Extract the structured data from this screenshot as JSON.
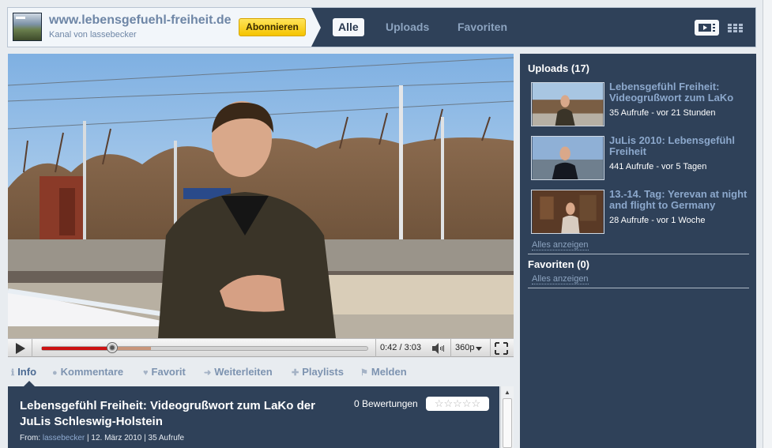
{
  "header": {
    "channel_title": "www.lebensgefuehl-freiheit.de",
    "channel_subtitle": "Kanal von lassebecker",
    "subscribe_label": "Abonnieren",
    "tabs": [
      {
        "label": "Alle",
        "active": true
      },
      {
        "label": "Uploads",
        "active": false
      },
      {
        "label": "Favoriten",
        "active": false
      }
    ],
    "view_icons": [
      "player-view-icon",
      "grid-view-icon"
    ]
  },
  "player": {
    "time": "0:42 / 3:03",
    "quality": "360p",
    "played_fraction": 0.215,
    "buffered_fraction": 0.335,
    "icons": [
      "play-icon",
      "volume-icon",
      "fullscreen-icon"
    ]
  },
  "actions": [
    {
      "label": "Info",
      "icon": "info-icon",
      "active": true
    },
    {
      "label": "Kommentare",
      "icon": "comment-icon",
      "active": false
    },
    {
      "label": "Favorit",
      "icon": "heart-icon",
      "active": false
    },
    {
      "label": "Weiterleiten",
      "icon": "forward-icon",
      "active": false
    },
    {
      "label": "Playlists",
      "icon": "plus-icon",
      "active": false
    },
    {
      "label": "Melden",
      "icon": "flag-icon",
      "active": false
    }
  ],
  "info": {
    "title": "Lebensgefühl Freiheit: Videogrußwort zum LaKo der JuLis Schleswig-Holstein",
    "ratings": "0 Bewertungen",
    "stars_filled": 0,
    "stars_total": 5,
    "from_label": "From:",
    "author": "lassebecker",
    "date": "12. März 2010",
    "views": "35 Aufrufe"
  },
  "sidebar": {
    "uploads_title": "Uploads (17)",
    "uploads": [
      {
        "title": "Lebensgefühl Freiheit: Videogrußwort zum LaKo",
        "meta": "35 Aufrufe - vor 21 Stunden"
      },
      {
        "title": "JuLis 2010: Lebensgefühl Freiheit",
        "meta": "441 Aufrufe - vor 5 Tagen"
      },
      {
        "title": "13.-14. Tag: Yerevan at night and flight to Germany",
        "meta": "28 Aufrufe - vor 1 Woche"
      }
    ],
    "show_all_label": "Alles anzeigen",
    "favorites_title": "Favoriten (0)",
    "favorites_show_all_label": "Alles anzeigen"
  },
  "colors": {
    "panel": "#2f4159",
    "accent_link": "#8ca8cc",
    "subscribe": "#f5c400",
    "progress_played": "#cc1111",
    "progress_buffered": "#c8957a"
  }
}
